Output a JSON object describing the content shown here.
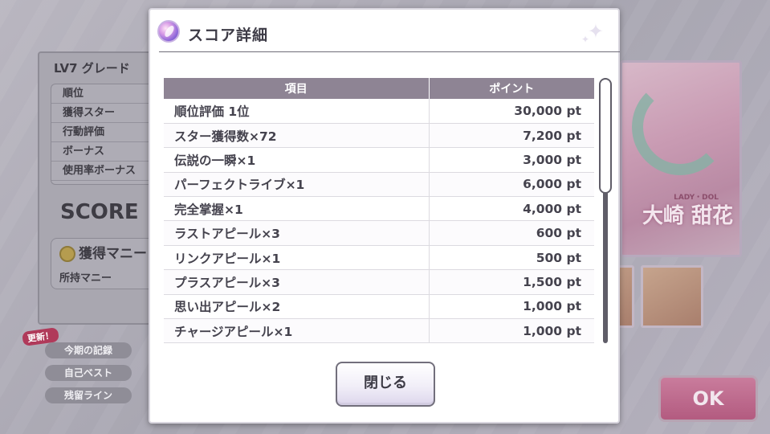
{
  "background": {
    "result_title": "LV7 グレード",
    "stats": [
      "順位",
      "獲得スター",
      "行動評価",
      "ボーナス",
      "使用率ボーナス"
    ],
    "score_label": "SCORE",
    "money_title": "獲得マニー",
    "money_row": "所持マニー",
    "new_badge": "更新！",
    "side_buttons": [
      "今期の記録",
      "自己ベスト",
      "残留ライン"
    ],
    "card_sub": "LADY・DOL",
    "card_name": "大崎 甜花",
    "ok_label": "OK"
  },
  "modal": {
    "title": "スコア詳細",
    "close_label": "閉じる"
  },
  "table": {
    "headers": [
      "項目",
      "ポイント"
    ],
    "rows": [
      {
        "item": "順位評価 1位",
        "points": "30,000 pt"
      },
      {
        "item": "スター獲得数×72",
        "points": "7,200 pt"
      },
      {
        "item": "伝説の一瞬×1",
        "points": "3,000 pt"
      },
      {
        "item": "パーフェクトライブ×1",
        "points": "6,000 pt"
      },
      {
        "item": "完全掌握×1",
        "points": "4,000 pt"
      },
      {
        "item": "ラストアピール×3",
        "points": "600 pt"
      },
      {
        "item": "リンクアピール×1",
        "points": "500 pt"
      },
      {
        "item": "プラスアピール×3",
        "points": "1,500 pt"
      },
      {
        "item": "思い出アピール×2",
        "points": "1,000 pt"
      },
      {
        "item": "チャージアピール×1",
        "points": "1,000 pt"
      }
    ]
  }
}
